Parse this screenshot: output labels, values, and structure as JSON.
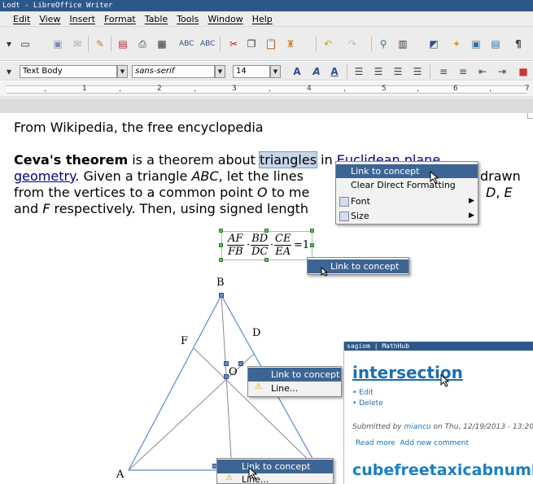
{
  "window": {
    "title": "Lodt - LibreOffice Writer"
  },
  "menu": [
    "Edit",
    "View",
    "Insert",
    "Format",
    "Table",
    "Tools",
    "Window",
    "Help"
  ],
  "toolbar": {
    "paragraph_style": "Text Body",
    "font_name": "sans-serif",
    "font_size": "14"
  },
  "ruler": {
    "numbers": [
      "1",
      "2",
      "3",
      "4",
      "5",
      "6",
      "7"
    ]
  },
  "document": {
    "line1": "From Wikipedia, the free encyclopedia",
    "line2_bold": "Ceva's theorem",
    "line2_a": " is a theorem about ",
    "line2_sel": "triangles",
    "line2_b": " in ",
    "line2_link": "Euclidean plane",
    "line3_link": "geometry",
    "line3_a": ". Given a triangle ",
    "line3_i": "ABC",
    "line3_b": ", let the lines",
    "line3_end": "drawn",
    "line4_a": "from the vertices to a common point ",
    "line4_i": "O",
    "line4_b": " to me",
    "line4_i2": "D",
    "line4_comma": ", ",
    "line4_i3": "E",
    "line5_a": "and ",
    "line5_i": "F",
    "line5_b": " respectively. Then, using signed length"
  },
  "formula": {
    "f1_num": "AF",
    "f1_den": "FB",
    "f2_num": "BD",
    "f2_den": "DC",
    "f3_num": "CE",
    "f3_den": "EA",
    "dot": "·",
    "eq": "=1"
  },
  "context_menu_main": {
    "items": [
      "Link to concept",
      "Clear Direct Formatting",
      "Font",
      "Size"
    ]
  },
  "context_menu_formula": {
    "items": [
      "Link to concept"
    ]
  },
  "context_menu_point": {
    "items": [
      "Link to concept",
      "Line..."
    ]
  },
  "context_menu_line": {
    "items": [
      "Link to concept",
      "Line..."
    ]
  },
  "triangle": {
    "labels": {
      "B": "B",
      "D": "D",
      "F": "F",
      "O": "O",
      "A": "A"
    }
  },
  "browser": {
    "title": "sagiom | MathHub",
    "heading": "intersection",
    "links": [
      "Edit",
      "Delete"
    ],
    "submitted_prefix": "Submitted by ",
    "submitted_user": "miancu",
    "submitted_suffix": " on Thu, 12/19/2013 - 13:20",
    "actions": [
      "Read more",
      "Add new comment"
    ],
    "heading2": "cubefreetaxicabnumbe"
  },
  "colors": {
    "title_bar": "#2d5788",
    "selection": "#3d6594",
    "link": "#000080",
    "web_link": "#1a6fb0"
  }
}
